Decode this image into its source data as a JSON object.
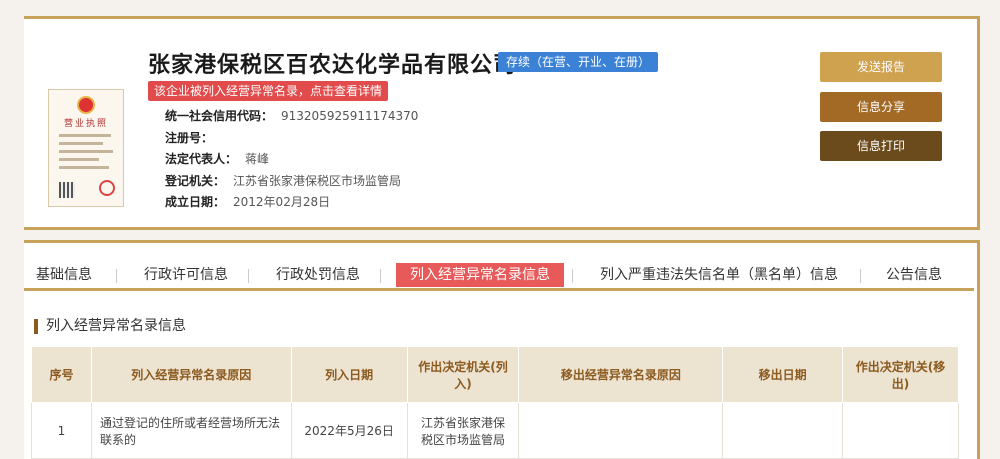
{
  "company": {
    "name": "张家港保税区百农达化学品有限公司",
    "status": "存续（在营、开业、在册）",
    "warning": "该企业被列入经营异常名录，点击查看详情",
    "license_title": "营业执照",
    "fields": [
      {
        "label": "统一社会信用代码：",
        "value": "913205925911174370"
      },
      {
        "label": "注册号：",
        "value": ""
      },
      {
        "label": "法定代表人：",
        "value": "蒋峰"
      },
      {
        "label": "登记机关：",
        "value": "江苏省张家港保税区市场监管局"
      },
      {
        "label": "成立日期：",
        "value": "2012年02月28日"
      }
    ]
  },
  "actions": {
    "report": "发送报告",
    "share": "信息分享",
    "print": "信息打印"
  },
  "tabs": [
    "基础信息",
    "行政许可信息",
    "行政处罚信息",
    "列入经营异常名录信息",
    "列入严重违法失信名单（黑名单）信息",
    "公告信息"
  ],
  "active_tab_index": 3,
  "section": {
    "title": "列入经营异常名录信息",
    "columns": [
      "序号",
      "列入经营异常名录原因",
      "列入日期",
      "作出决定机关(列入)",
      "移出经营异常名录原因",
      "移出日期",
      "作出决定机关(移出)"
    ],
    "rows": [
      [
        "1",
        "通过登记的住所或者经营场所无法联系的",
        "2022年5月26日",
        "江苏省张家港保税区市场监管局",
        "",
        "",
        ""
      ]
    ]
  },
  "colors": {
    "accent": "#c7a25b",
    "warning": "#e24b4b",
    "status": "#3b82d6"
  }
}
